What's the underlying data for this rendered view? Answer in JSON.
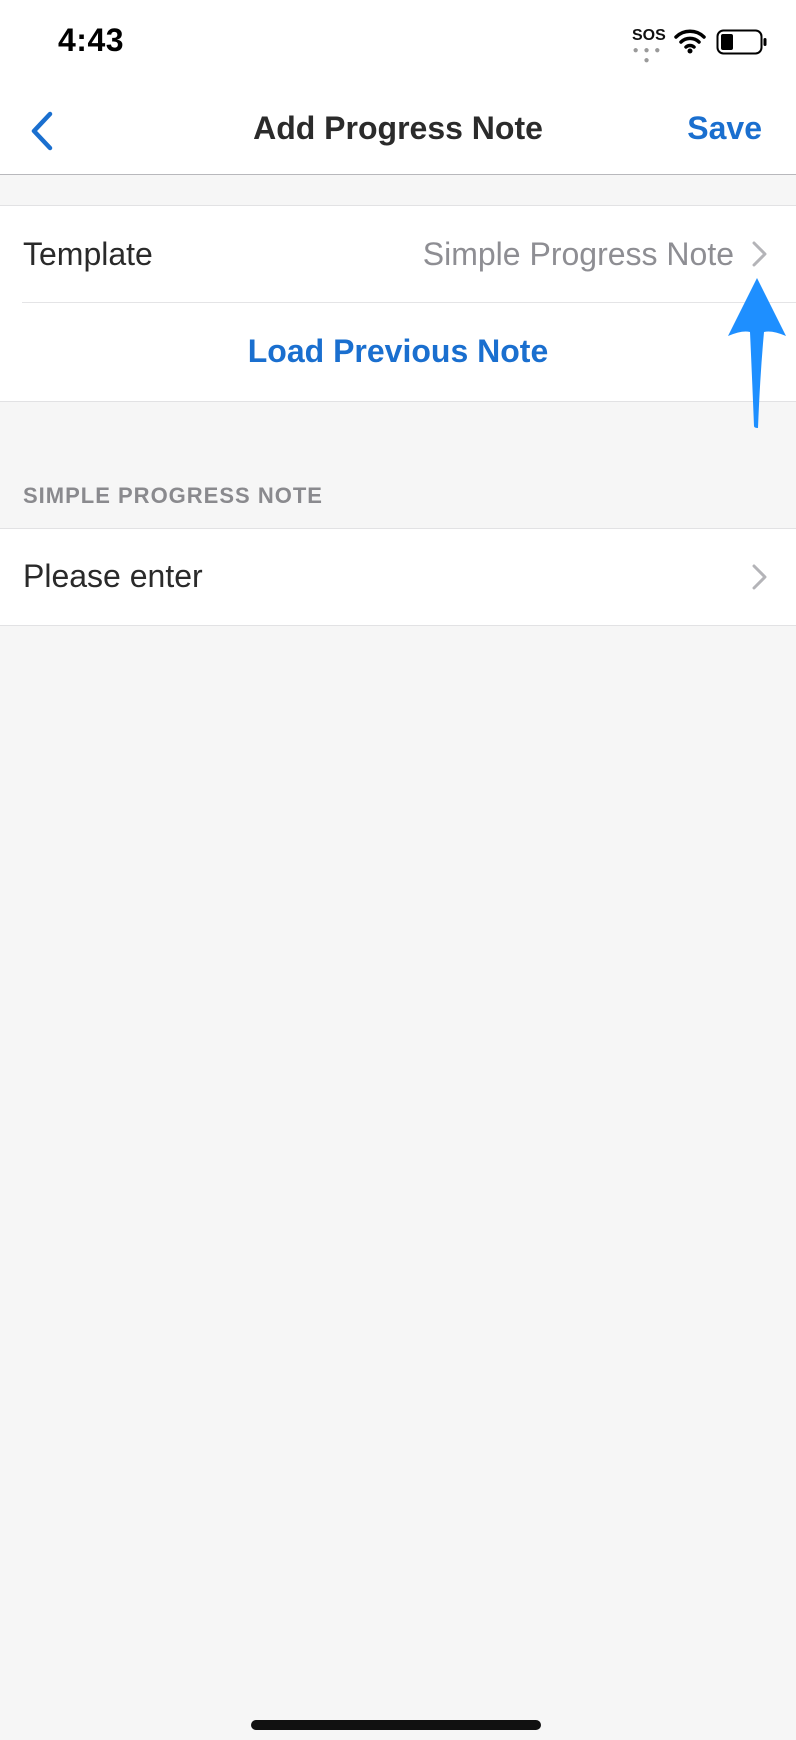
{
  "status_bar": {
    "time": "4:43",
    "sos": "SOS"
  },
  "nav": {
    "back_icon": "chevron-left-icon",
    "title": "Add Progress Note",
    "save_label": "Save"
  },
  "template_row": {
    "label": "Template",
    "value": "Simple Progress Note"
  },
  "load_previous_label": "Load Previous Note",
  "section": {
    "header": "SIMPLE PROGRESS NOTE",
    "row_label": "Please enter"
  },
  "colors": {
    "accent": "#1a6fcf",
    "annotation_arrow": "#1e8fff",
    "background": "#f6f6f6"
  }
}
